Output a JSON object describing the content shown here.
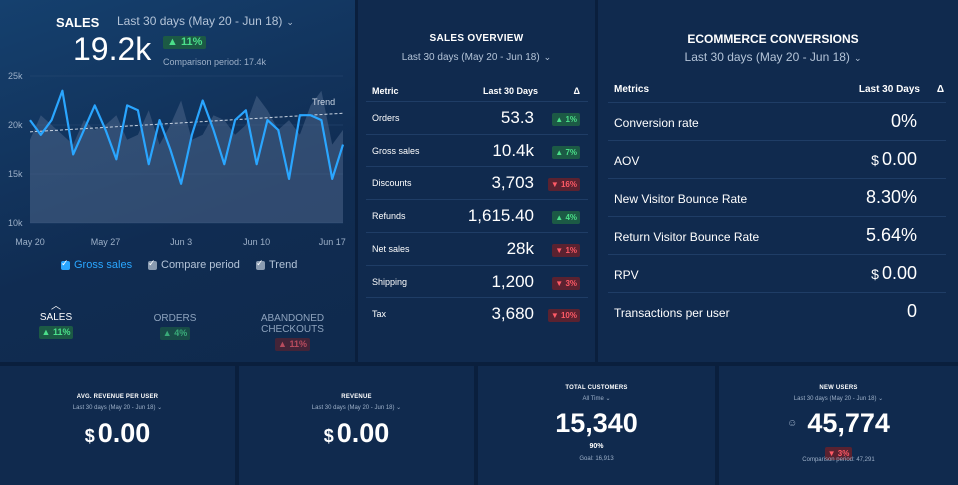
{
  "sales": {
    "title": "SALES",
    "period": "Last 30 days (May 20 - Jun 18)",
    "value": "19.2k",
    "change": "▲ 11%",
    "comparison": "Comparison period: 17.4k",
    "trend_label": "Trend",
    "legend": [
      {
        "label": "Gross sales",
        "checked": true,
        "color": "#2aa6ff"
      },
      {
        "label": "Compare period",
        "checked": true,
        "color": "#8a9bb0"
      },
      {
        "label": "Trend",
        "checked": true,
        "color": "#8a9bb0"
      }
    ],
    "tabs": [
      {
        "label": "SALES",
        "change": "▲ 11%",
        "dir": "up",
        "active": true
      },
      {
        "label": "ORDERS",
        "change": "▲ 4%",
        "dir": "up",
        "active": false
      },
      {
        "label": "ABANDONED\nCHECKOUTS",
        "change": "▲ 11%",
        "dir": "down",
        "active": false
      }
    ]
  },
  "chart_data": {
    "type": "line",
    "x": [
      "May 20",
      "May 21",
      "May 22",
      "May 23",
      "May 24",
      "May 25",
      "May 26",
      "May 27",
      "May 28",
      "May 29",
      "May 30",
      "May 31",
      "Jun 1",
      "Jun 2",
      "Jun 3",
      "Jun 4",
      "Jun 5",
      "Jun 6",
      "Jun 7",
      "Jun 8",
      "Jun 9",
      "Jun 10",
      "Jun 11",
      "Jun 12",
      "Jun 13",
      "Jun 14",
      "Jun 15",
      "Jun 16",
      "Jun 17",
      "Jun 18"
    ],
    "x_tick_labels": [
      "May 20",
      "May 27",
      "Jun 3",
      "Jun 10",
      "Jun 17"
    ],
    "y_tick_labels": [
      "25k",
      "20k",
      "15k",
      "10k"
    ],
    "ylim": [
      10000,
      25000
    ],
    "series": [
      {
        "name": "Gross sales",
        "values": [
          20500,
          19000,
          20500,
          23500,
          17000,
          19500,
          22000,
          19500,
          16500,
          22000,
          21500,
          16000,
          20500,
          17500,
          14000,
          19000,
          22500,
          19500,
          16000,
          20500,
          21500,
          16000,
          20500,
          19500,
          14500,
          21000,
          21000,
          20500,
          14500,
          18000
        ],
        "color": "#2aa6ff"
      },
      {
        "name": "Compare period",
        "values": [
          18500,
          21000,
          20000,
          19000,
          18000,
          20500,
          19500,
          20000,
          21000,
          18500,
          19000,
          21500,
          18000,
          20000,
          22500,
          18500,
          19000,
          21000,
          20500,
          19000,
          20000,
          23000,
          21500,
          19500,
          20500,
          19000,
          22000,
          23500,
          18000,
          19500
        ],
        "color": "#4a6488"
      },
      {
        "name": "Trend",
        "values": [
          19300,
          21200
        ],
        "color": "#c9d4e2"
      }
    ],
    "grid": true,
    "legend_position": "bottom"
  },
  "overview": {
    "title": "SALES OVERVIEW",
    "period": "Last 30 days (May 20 - Jun 18)",
    "headers": {
      "metric": "Metric",
      "period": "Last 30 Days",
      "delta": "Δ"
    },
    "rows": [
      {
        "label": "Orders",
        "value": "53.3",
        "change": "▲ 1%",
        "dir": "up"
      },
      {
        "label": "Gross sales",
        "value": "10.4k",
        "change": "▲ 7%",
        "dir": "up"
      },
      {
        "label": "Discounts",
        "value": "3,703",
        "change": "▼ 16%",
        "dir": "down"
      },
      {
        "label": "Refunds",
        "value": "1,615.40",
        "change": "▲ 4%",
        "dir": "up"
      },
      {
        "label": "Net sales",
        "value": "28k",
        "change": "▼ 1%",
        "dir": "down"
      },
      {
        "label": "Shipping",
        "value": "1,200",
        "change": "▼ 3%",
        "dir": "down"
      },
      {
        "label": "Tax",
        "value": "3,680",
        "change": "▼ 10%",
        "dir": "down"
      }
    ]
  },
  "conversions": {
    "title": "ECOMMERCE CONVERSIONS",
    "period": "Last 30 days (May 20 - Jun 18)",
    "headers": {
      "metric": "Metrics",
      "period": "Last 30 Days",
      "delta": "Δ"
    },
    "rows": [
      {
        "label": "Conversion rate",
        "value": "0%",
        "currency": ""
      },
      {
        "label": "AOV",
        "value": "0.00",
        "currency": "$"
      },
      {
        "label": "New Visitor Bounce Rate",
        "value": "8.30%",
        "currency": ""
      },
      {
        "label": "Return Visitor Bounce Rate",
        "value": "5.64%",
        "currency": ""
      },
      {
        "label": "RPV",
        "value": "0.00",
        "currency": "$"
      },
      {
        "label": "Transactions per user",
        "value": "0",
        "currency": ""
      }
    ]
  },
  "tiles": [
    {
      "title": "AVG. REVENUE PER USER",
      "period": "Last 30 days (May 20 - Jun 18)",
      "currency": "$",
      "value": "0.00"
    },
    {
      "title": "REVENUE",
      "period": "Last 30 days (May 20 - Jun 18)",
      "currency": "$",
      "value": "0.00"
    },
    {
      "title": "TOTAL CUSTOMERS",
      "period": "All Time",
      "value": "15,340",
      "percent": "90%",
      "goal": "Goal: 16,913"
    },
    {
      "title": "NEW USERS",
      "period": "Last 30 days (May 20 - Jun 18)",
      "value": "45,774",
      "change": "▼ 3%",
      "comparison": "Comparison period: 47,291",
      "icon": "user-icon"
    }
  ]
}
